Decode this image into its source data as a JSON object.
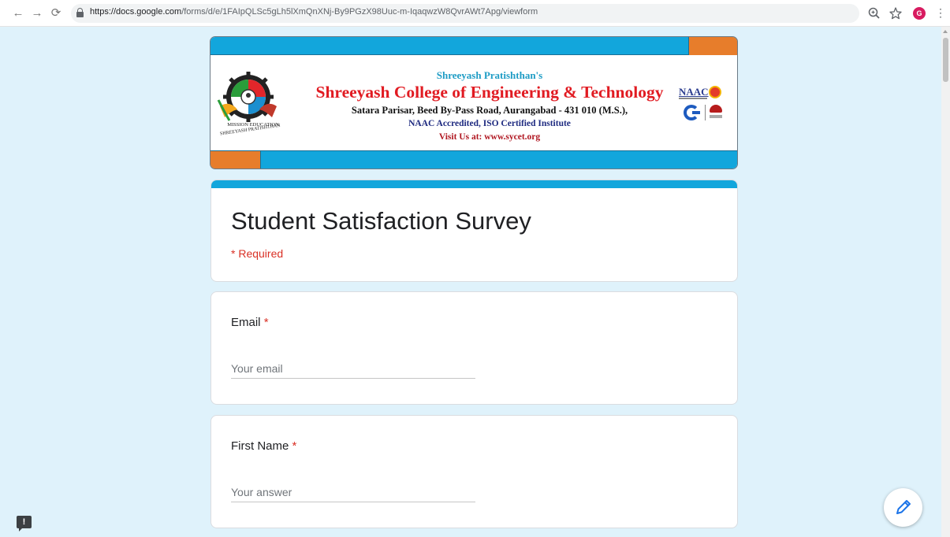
{
  "browser": {
    "back_icon": "arrow-left-icon",
    "forward_icon": "arrow-right-icon",
    "reload_icon": "reload-icon",
    "url_domain": "https://docs.google.com",
    "url_path": "/forms/d/e/1FAIpQLSc5gLh5lXmQnXNj-By9PGzX98Uuc-m-IqaqwzW8QvrAWt7Apg/viewform",
    "avatar_letter": "G"
  },
  "banner": {
    "line1": "Shreeyash Pratishthan's",
    "line2": "Shreeyash College of Engineering & Technology",
    "line3": "Satara Parisar, Beed By-Pass Road, Aurangabad - 431 010 (M.S.),",
    "line4": "NAAC Accredited, ISO Certified Institute",
    "line5": "Visit Us at: www.sycet.org",
    "logo_ring_text": "SHREEYASH PRATISHTHAN",
    "logo_caption": "MISSION EDUCATION",
    "naac_label": "NAAC",
    "colors": {
      "band": "#12a6dc",
      "accent": "#e77d2b",
      "title_red": "#e11b22"
    }
  },
  "form": {
    "title": "Student Satisfaction Survey",
    "required_note": "* Required",
    "questions": [
      {
        "label": "Email",
        "required_mark": "*",
        "placeholder": "Your email"
      },
      {
        "label": "First Name",
        "required_mark": "*",
        "placeholder": "Your answer"
      }
    ],
    "accent_color": "#12a6dc",
    "required_color": "#d93025"
  },
  "floating": {
    "feedback_icon": "report-feedback-icon",
    "edit_icon": "pencil-edit-icon"
  }
}
